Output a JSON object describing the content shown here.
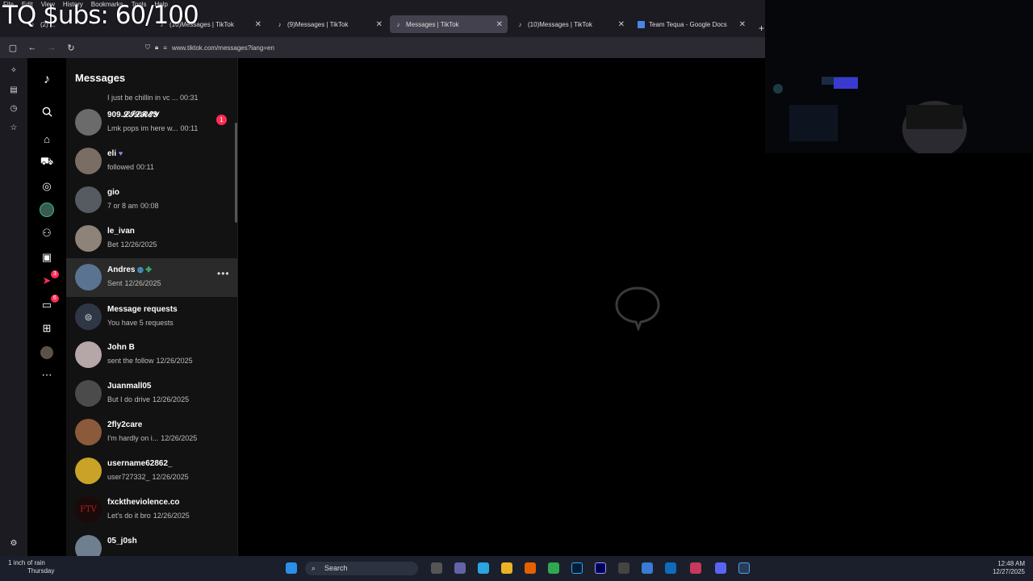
{
  "overlay": {
    "title": "TQ $ubs: 60/100"
  },
  "menu": [
    "File",
    "Edit",
    "View",
    "History",
    "Bookmarks",
    "Tools",
    "Help"
  ],
  "tabs": [
    {
      "label": "(2) ...",
      "active": false
    },
    {
      "label": "(10)Messages | TikTok",
      "active": false
    },
    {
      "label": "(9)Messages | TikTok",
      "active": false
    },
    {
      "label": "Messages | TikTok",
      "active": true
    },
    {
      "label": "(10)Messages | TikTok",
      "active": false
    },
    {
      "label": "Team Tequa - Google Docs",
      "active": false
    }
  ],
  "url": "www.tiktok.com/messages?lang=en",
  "messages_title": "Messages",
  "partial_preview": "I just be chillin in vc ... 00:31",
  "conversations": [
    {
      "name": "909.𝓛𝓘𝓛𝓡𝓔𝓨",
      "preview": "Lmk pops im here w...",
      "time": "00:11",
      "unread": "1",
      "avatar": "#6b6b6b"
    },
    {
      "name": "eli",
      "preview": "followed",
      "time": "00:11",
      "avatar": "#7a6e64"
    },
    {
      "name": "gio",
      "preview": "7 or 8 am",
      "time": "00:08",
      "avatar": "#555b60"
    },
    {
      "name": "le_ivan",
      "preview": "Bet",
      "time": "12/26/2025",
      "avatar": "#8d8378"
    },
    {
      "name": "Andres",
      "preview": "Sent",
      "time": "12/26/2025",
      "avatar": "#5a7390",
      "hover": true
    },
    {
      "name": "Message requests",
      "preview": "You have 5 requests",
      "time": "",
      "avatar": "#2f3645",
      "system": true
    },
    {
      "name": "John B",
      "preview": "sent the follow",
      "time": "12/26/2025",
      "avatar": "#b5a6a8"
    },
    {
      "name": "Juanmall05",
      "preview": "But I do drive",
      "time": "12/26/2025",
      "avatar": "#4b4b4b"
    },
    {
      "name": "2fly2care",
      "preview": "I'm hardly on i...",
      "time": "12/26/2025",
      "avatar": "#8a5a3a"
    },
    {
      "name": "username62862_",
      "preview": "user727332_",
      "time": "12/26/2025",
      "avatar": "#c9a227"
    },
    {
      "name": "fxcktheviolence.co",
      "preview": "Let's do it bro",
      "time": "12/26/2025",
      "avatar": "#1a0a0a"
    },
    {
      "name": "05_j0sh",
      "preview": "",
      "time": "",
      "avatar": "#6f7f8f"
    }
  ],
  "nav_badges": {
    "activity": "3",
    "messages": "6"
  },
  "taskbar": {
    "weather_line1": "1 inch of rain",
    "weather_line2": "Thursday",
    "search": "Search",
    "time": "12:48 AM",
    "date": "12/27/2025"
  },
  "colors": {
    "accent": "#fe2c55",
    "panel": "#121212"
  }
}
